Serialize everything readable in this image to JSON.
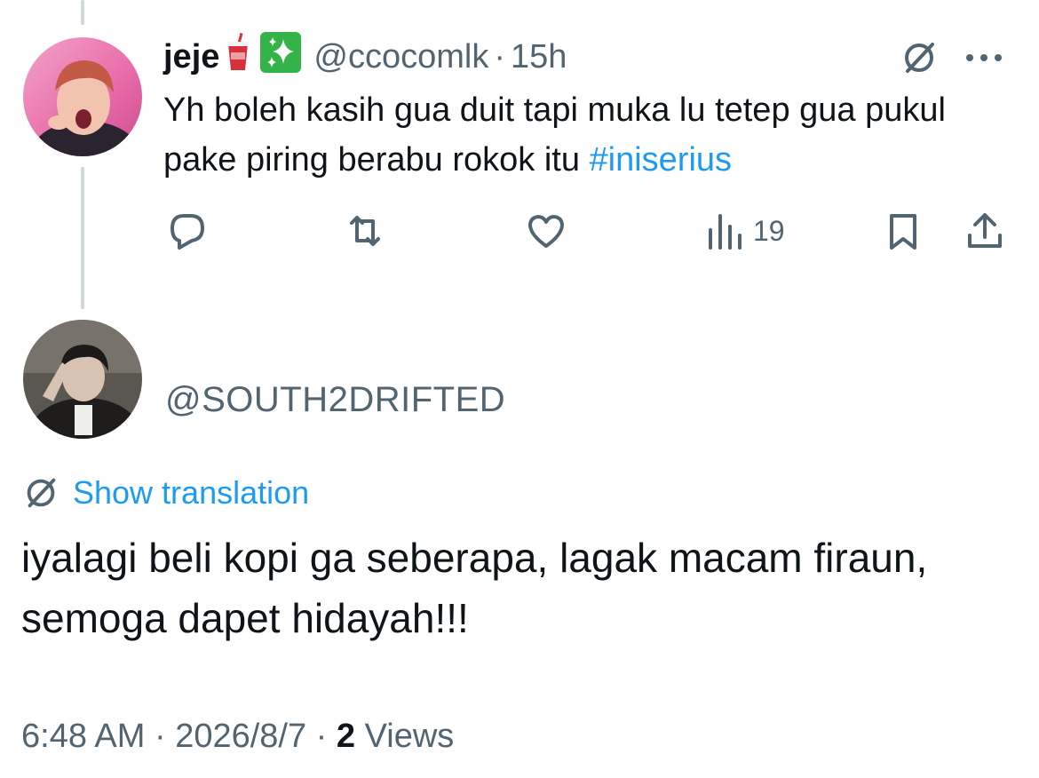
{
  "reply_tweet": {
    "display_name": "jeje",
    "name_emojis": [
      "cup-with-straw-icon",
      "sparkles-icon"
    ],
    "handle": "@ccocomlk",
    "separator": "·",
    "time": "15h",
    "text": "Yh boleh kasih gua duit tapi muka lu tetep gua pukul pake piring berabu rokok itu ",
    "hashtag": "#iniserius",
    "actions": {
      "reply_icon": "reply-icon",
      "retweet_icon": "retweet-icon",
      "like_icon": "like-icon",
      "views_icon": "views-icon",
      "views_count": "19",
      "bookmark_icon": "bookmark-icon",
      "share_icon": "share-icon"
    },
    "top_icons": [
      "grok-icon",
      "more-icon"
    ]
  },
  "main_tweet": {
    "handle": "@SOUTH2DRIFTED",
    "translate_label": "Show translation",
    "text": "iyalagi beli kopi ga seberapa, lagak macam firaun, semoga dapet hidayah!!!",
    "time": "6:48 AM",
    "sep1": " · ",
    "date": "2026/8/7",
    "sep2": " · ",
    "views_num": "2",
    "views_label": " Views"
  },
  "colors": {
    "text": "#0f1419",
    "secondary": "#536471",
    "accent": "#1d9bf0",
    "thread_line": "#cfd9de"
  }
}
